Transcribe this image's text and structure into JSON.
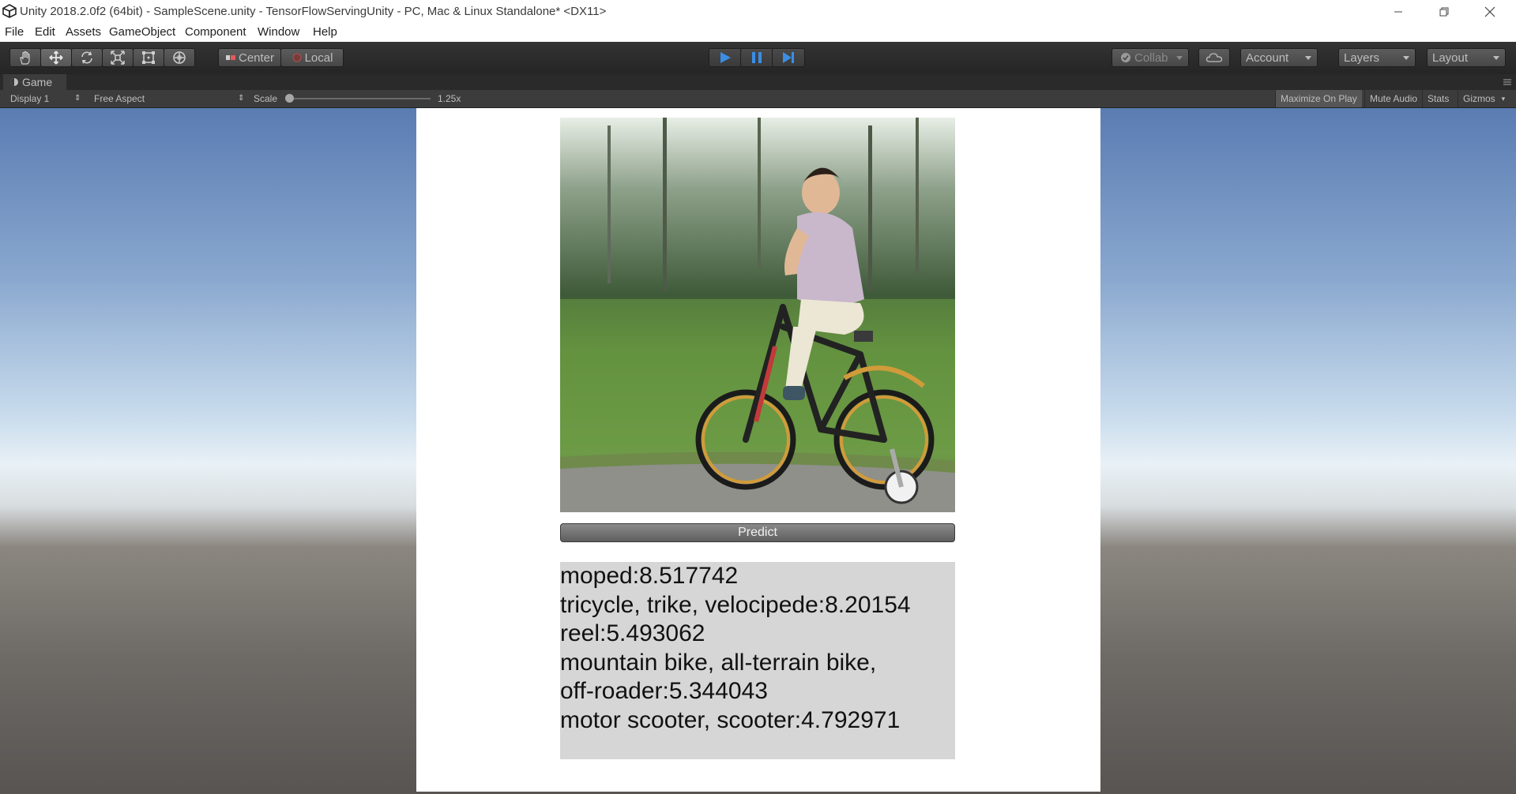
{
  "window": {
    "title": "Unity 2018.2.0f2 (64bit) - SampleScene.unity - TensorFlowServingUnity - PC, Mac & Linux Standalone* <DX11>"
  },
  "menu": [
    "File",
    "Edit",
    "Assets",
    "GameObject",
    "Component",
    "Window",
    "Help"
  ],
  "toolbar": {
    "pivot_label": "Center",
    "rotation_label": "Local",
    "collab_label": "Collab",
    "account_label": "Account",
    "layers_label": "Layers",
    "layout_label": "Layout"
  },
  "game": {
    "tab_label": "Game",
    "display_label": "Display 1",
    "aspect_label": "Free Aspect",
    "scale_label": "Scale",
    "scale_value": "1.25x",
    "maximize_label": "Maximize On Play",
    "mute_label": "Mute Audio",
    "stats_label": "Stats",
    "gizmos_label": "Gizmos"
  },
  "app": {
    "predict_label": "Predict",
    "results": [
      "moped:8.517742",
      "tricycle, trike, velocipede:8.20154",
      "reel:5.493062",
      "mountain bike, all-terrain bike,",
      "off-roader:5.344043",
      "motor scooter, scooter:4.792971"
    ]
  },
  "icons": [
    "unity-logo-icon",
    "hand-tool-icon",
    "move-tool-icon",
    "rotate-tool-icon",
    "scale-tool-icon",
    "rect-tool-icon",
    "transform-tool-icon",
    "play-icon",
    "pause-icon",
    "step-icon",
    "cloud-icon"
  ],
  "colors": {
    "toolbar_bg": "#2c2c2c",
    "play_blue": "#3a8ee6",
    "results_bg": "#d6d6d6"
  }
}
